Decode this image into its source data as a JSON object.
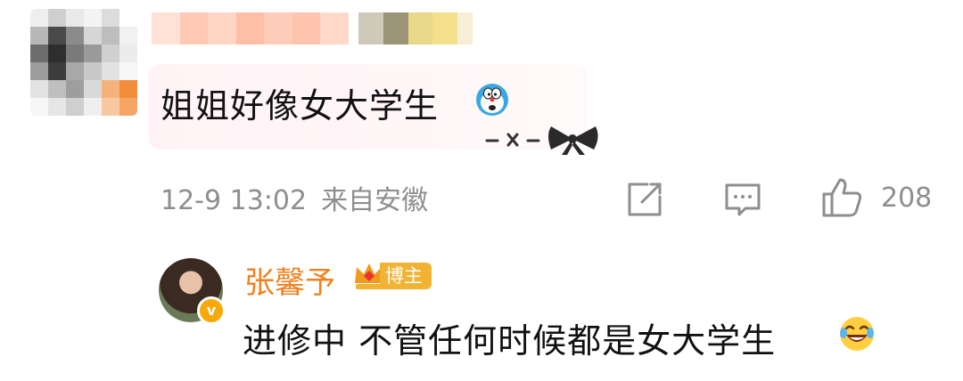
{
  "comment": {
    "text": "姐姐好像女大学生",
    "emoji": "doraemon-emoji",
    "decoration": "bow-icon",
    "date": "12-9 13:02",
    "location": "来自安徽",
    "likes": "208"
  },
  "actions": {
    "share_icon": "share-icon",
    "reply_icon": "comment-icon",
    "like_icon": "thumbs-up-icon"
  },
  "reply": {
    "author": "张馨予",
    "badge": "博主",
    "text": "进修中 不管任何时候都是女大学生",
    "emoji": "laughing-crying-emoji",
    "verified_mark": "v"
  },
  "colors": {
    "author_orange": "#f2801f",
    "badge_gold": "#f2b233",
    "meta_gray": "#8e8e8e",
    "bubble_pink": "#fff3f6"
  }
}
